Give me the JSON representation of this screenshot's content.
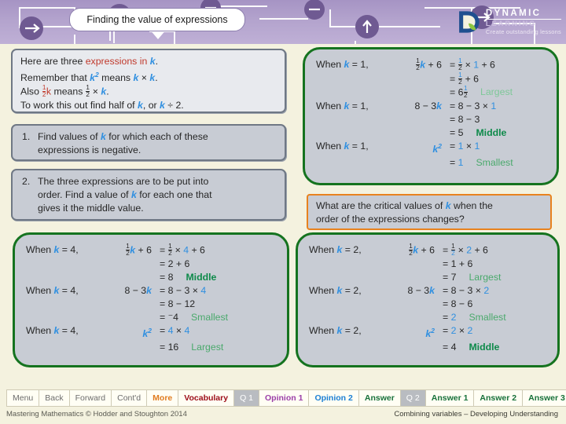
{
  "header": {
    "title": "Finding the value of expressions",
    "logo": {
      "word1": "DYNAMIC",
      "word2": "LEARNING",
      "tagline": "Create outstanding lessons"
    }
  },
  "intro": {
    "line1_a": "Here are three ",
    "line1_b": "expressions in ",
    "line1_k": "k",
    "line1_end": ".",
    "line2_a": "Remember that ",
    "line2_k": "k",
    "line2_sup": "2",
    "line2_b": " means ",
    "line2_k2": "k",
    "line2_c": " × ",
    "line2_k3": "k",
    "line2_end": ".",
    "line3_a": "Also ",
    "line3_k": "k",
    "line3_b": " means ",
    "line3_c": " × ",
    "line3_k2": "k",
    "line3_end": ".",
    "line4_a": "To work this out find half of ",
    "line4_k": "k",
    "line4_b": ", or ",
    "line4_k2": "k",
    "line4_c": " ÷ 2."
  },
  "questions": [
    {
      "number": "1.",
      "text_a": "Find values of ",
      "k": "k",
      "text_b": " for which each of these",
      "text_line2": "expressions is negative."
    },
    {
      "number": "2.",
      "text_a": "The three expressions are to be put into",
      "text_line2_a": "order. Find a value of ",
      "k": "k",
      "text_line2_b": " for each one that",
      "text_line3": "gives it the middle value."
    }
  ],
  "critical_question": {
    "line1_a": "What are the critical values of ",
    "line1_k": "k",
    "line1_b": " when the",
    "line2": "order of the expressions changes?"
  },
  "calc_k1": {
    "k_value": "1",
    "when_label": "When k = 1,",
    "blocks": [
      {
        "expression": "k + 6",
        "expression_prefix_frac": "1/2",
        "steps": [
          "= ½ × 1 + 6",
          "= ½ + 6",
          "= 6½"
        ],
        "substituted": "1",
        "result": "6½",
        "tag": "Largest",
        "tag_style": "light"
      },
      {
        "expression": "8 − 3k",
        "steps": [
          "= 8 − 3 × 1",
          "= 8 − 3",
          "= 5"
        ],
        "substituted": "1",
        "result": "5",
        "tag": "Middle",
        "tag_style": "dark"
      },
      {
        "expression": "k",
        "expression_sup": "2",
        "steps": [
          "= 1 × 1",
          "= 1"
        ],
        "substituted": "1",
        "result": "1",
        "tag": "Smallest",
        "tag_style": "mid"
      }
    ]
  },
  "calc_k4": {
    "k_value": "4",
    "when_label": "When k = 4,",
    "blocks": [
      {
        "expression": "k + 6",
        "expression_prefix_frac": "1/2",
        "steps": [
          "= ½ × 4 + 6",
          "= 2 + 6",
          "= 8"
        ],
        "substituted": "4",
        "result": "8",
        "tag": "Middle",
        "tag_style": "dark"
      },
      {
        "expression": "8 − 3k",
        "steps": [
          "= 8 − 3 × 4",
          "= 8 − 12",
          "= ⁻4"
        ],
        "substituted": "4",
        "result": "⁻4",
        "tag": "Smallest",
        "tag_style": "mid"
      },
      {
        "expression": "k",
        "expression_sup": "2",
        "steps": [
          "= 4 × 4",
          "= 16"
        ],
        "substituted": "4",
        "result": "16",
        "tag": "Largest",
        "tag_style": "mid"
      }
    ]
  },
  "calc_k2": {
    "k_value": "2",
    "when_label": "When k = 2,",
    "blocks": [
      {
        "expression": "k + 6",
        "expression_prefix_frac": "1/2",
        "steps": [
          "= ½ × 2 + 6",
          "= 1 + 6",
          "= 7"
        ],
        "substituted": "2",
        "result": "7",
        "tag": "Largest",
        "tag_style": "mid"
      },
      {
        "expression": "8 − 3k",
        "steps": [
          "= 8 − 3 × 2",
          "= 8 − 6",
          "= 2"
        ],
        "substituted": "2",
        "result": "2",
        "tag": "Smallest",
        "tag_style": "mid"
      },
      {
        "expression": "k",
        "expression_sup": "2",
        "steps": [
          "= 2 × 2",
          "= 4"
        ],
        "substituted": "2",
        "result": "4",
        "tag": "Middle",
        "tag_style": "dark"
      }
    ]
  },
  "toolbar": [
    {
      "label": "Menu",
      "color": "#6d6d6d",
      "bold": false,
      "dim": false
    },
    {
      "label": "Back",
      "color": "#6d6d6d",
      "bold": false,
      "dim": false
    },
    {
      "label": "Forward",
      "color": "#6d6d6d",
      "bold": false,
      "dim": false
    },
    {
      "label": "Cont'd",
      "color": "#6d6d6d",
      "bold": false,
      "dim": false
    },
    {
      "label": "More",
      "color": "#e07b1e",
      "bold": true,
      "dim": false
    },
    {
      "label": "Vocabulary",
      "color": "#9c0c18",
      "bold": true,
      "dim": false
    },
    {
      "label": "Q 1",
      "color": "#ffffff",
      "bold": false,
      "dim": true
    },
    {
      "label": "Opinion 1",
      "color": "#9b3fa8",
      "bold": true,
      "dim": false
    },
    {
      "label": "Opinion 2",
      "color": "#1b7fd4",
      "bold": true,
      "dim": false
    },
    {
      "label": "Answer",
      "color": "#17713a",
      "bold": true,
      "dim": false
    },
    {
      "label": "Q 2",
      "color": "#ffffff",
      "bold": false,
      "dim": true
    },
    {
      "label": "Answer 1",
      "color": "#17713a",
      "bold": true,
      "dim": false
    },
    {
      "label": "Answer 2",
      "color": "#17713a",
      "bold": true,
      "dim": false
    },
    {
      "label": "Answer 3",
      "color": "#17713a",
      "bold": true,
      "dim": false
    }
  ],
  "footer": {
    "left": "Mastering Mathematics © Hodder and Stoughton 2014",
    "right": "Combining variables – Developing Understanding"
  },
  "colors": {
    "header_purple": "#b3a3cd",
    "page_bg": "#f4f2df",
    "box_fill": "#c8ccd4",
    "green_border": "#15731f",
    "orange_border": "#e8821e",
    "k_blue": "#2f8fe0",
    "accent_red": "#c0392b"
  }
}
